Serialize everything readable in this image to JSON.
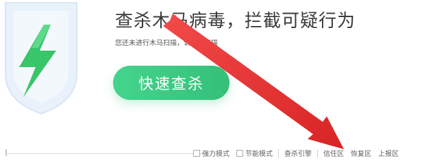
{
  "header": {
    "title": "查杀木马病毒，拦截可疑行为",
    "subtitle": "您还未进行木马扫描，请立即扫描"
  },
  "main": {
    "scan_button_label": "快速查杀"
  },
  "options": {
    "strong_mode": "强力模式",
    "power_saving_mode": "节能模式"
  },
  "links": {
    "engine": "查杀引擎",
    "trust_zone": "信任区",
    "restore_zone": "恢复区",
    "report_zone": "上报区"
  },
  "colors": {
    "scan_button": "#40cd86",
    "arrow": "#e53935",
    "shield": "#e9f2fb",
    "bolt": "#39c56a"
  }
}
